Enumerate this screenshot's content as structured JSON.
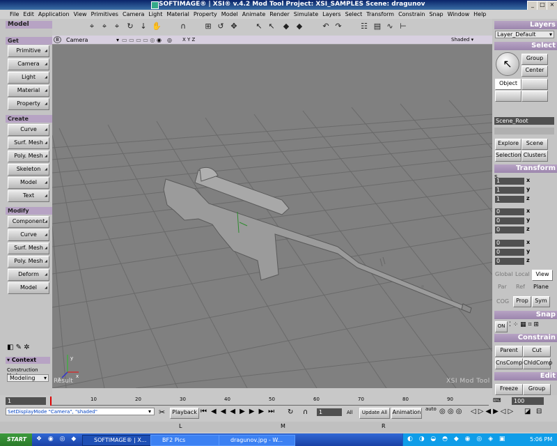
{
  "window": {
    "title": "SOFTIMAGE® | XSI® v.4.2 Mod Tool Project: XSI_SAMPLES     Scene: dragunov"
  },
  "menu": [
    "File",
    "Edit",
    "Application",
    "View",
    "Primitives",
    "Camera",
    "Light",
    "Material",
    "Property",
    "Model",
    "Animate",
    "Render",
    "Simulate",
    "Layers",
    "Select",
    "Transform",
    "Constrain",
    "Snap",
    "Window",
    "Help"
  ],
  "left_panel": {
    "title": "Model",
    "get": {
      "header": "Get",
      "items": [
        "Primitive",
        "Camera",
        "Light",
        "Material",
        "Property"
      ]
    },
    "create": {
      "header": "Create",
      "items": [
        "Curve",
        "Surf. Mesh",
        "Poly. Mesh",
        "Skeleton",
        "Model",
        "Text"
      ]
    },
    "modify": {
      "header": "Modify",
      "items": [
        "Component",
        "Curve",
        "Surf. Mesh",
        "Poly. Mesh",
        "Deform",
        "Model"
      ]
    },
    "context": {
      "header": "Context",
      "mode_label": "Construction Mode",
      "mode_value": "Modeling"
    }
  },
  "viewport": {
    "letter": "B",
    "camera": "Camera",
    "axes": "X Y Z",
    "shading": "Shaded",
    "watermark": "XSI  Mod  Tool",
    "result_label": "Result"
  },
  "right_panel": {
    "layers": {
      "header": "Layers",
      "dropdown": "Layer_Default"
    },
    "select": {
      "header": "Select",
      "group": "Group",
      "center": "Center",
      "object": "Object",
      "scene_root": "Scene_Root",
      "explore": "Explore",
      "scene": "Scene",
      "selection": "Selection",
      "clusters": "Clusters"
    },
    "transform": {
      "header": "Transform",
      "scale": [
        "1",
        "1",
        "1"
      ],
      "rotate": [
        "0",
        "0",
        "0"
      ],
      "translate": [
        "0",
        "0",
        "0"
      ],
      "axis_labels": [
        "x",
        "y",
        "z"
      ],
      "global": "Global",
      "local": "Local",
      "view": "View",
      "par": "Par",
      "ref": "Ref",
      "plane": "Plane",
      "cog": "COG",
      "prop": "Prop",
      "sym": "Sym"
    },
    "snap": {
      "header": "Snap",
      "on": "ON"
    },
    "constrain": {
      "header": "Constrain",
      "parent": "Parent",
      "cut": "Cut",
      "cnscomp": "CnsComp",
      "childcomp": "ChldComp"
    },
    "edit": {
      "header": "Edit",
      "freeze": "Freeze",
      "group": "Group"
    }
  },
  "timeline": {
    "start": "1",
    "end": "100",
    "ticks": [
      "10",
      "20",
      "30",
      "40",
      "50",
      "60",
      "70",
      "80",
      "90"
    ]
  },
  "playback": {
    "command": "SetDisplayMode \"Camera\", \"shaded\"",
    "playback_label": "Playback",
    "frame": "1",
    "all": "All",
    "update_all": "Update All",
    "animation": "Animation",
    "auto": "auto"
  },
  "status": {
    "l": "L",
    "m": "M",
    "r": "R"
  },
  "taskbar": {
    "start": "START",
    "tasks": [
      "SOFTIMAGE® | X...",
      "BF2 Pics",
      "dragunov.jpg - W..."
    ],
    "clock": "5:06 PM"
  }
}
